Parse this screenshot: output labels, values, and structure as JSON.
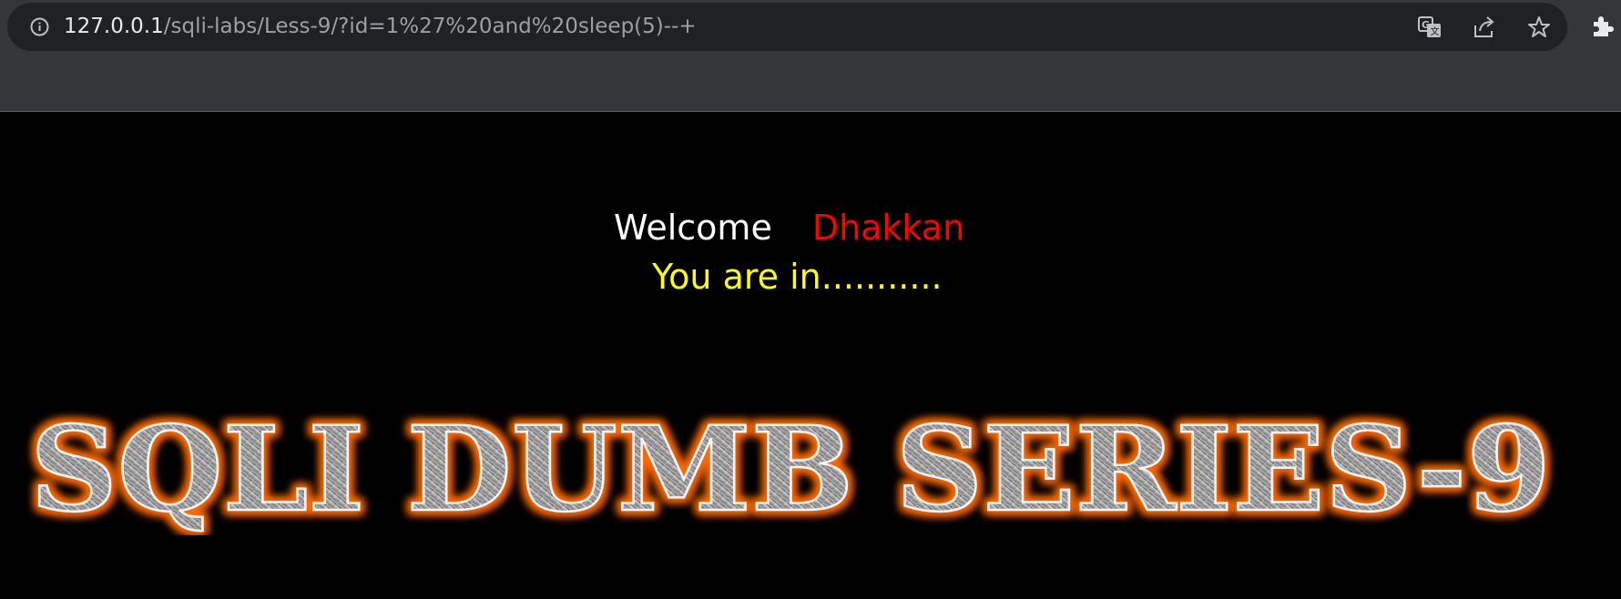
{
  "browser": {
    "url_host": "127.0.0.1",
    "url_path": "/sqli-labs/Less-9/?id=1%27%20and%20sleep(5)--+",
    "icons": [
      "info-icon",
      "translate-icon",
      "share-icon",
      "star-icon",
      "extensions-icon"
    ]
  },
  "page": {
    "welcome_word": "Welcome",
    "welcome_name": "Dhakkan",
    "status_text": "You are in...........",
    "banner_text": "SQLI DUMB SERIES-9"
  },
  "colors": {
    "page_background": "#000000",
    "welcome": "#ffffff",
    "name": "#ff0000",
    "status": "#ffff00",
    "banner_glow": "#ff6a00",
    "banner_metal": "#9a9a9a"
  }
}
